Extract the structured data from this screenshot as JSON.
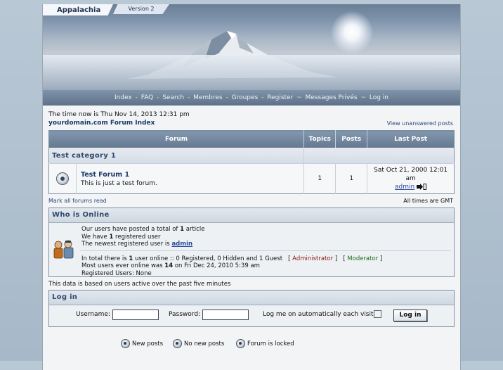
{
  "header": {
    "site_tab": "Appalachia",
    "version_tab": "Version 2"
  },
  "nav": {
    "items": [
      "Index",
      "FAQ",
      "Search",
      "Membres",
      "Groupes",
      "Register",
      "Messages Privés",
      "Log in"
    ]
  },
  "info": {
    "time_text": "The time now is Thu Nov 14, 2013 12:31 pm",
    "index_title": "yourdomain.com Forum Index",
    "view_unanswered": "View unanswered posts"
  },
  "table": {
    "headers": {
      "forum": "Forum",
      "topics": "Topics",
      "posts": "Posts",
      "last_post": "Last Post"
    },
    "category": "Test category 1",
    "forum": {
      "name": "Test Forum 1",
      "description": "This is just a test forum.",
      "topics": "1",
      "posts": "1",
      "last_post_date": "Sat Oct 21, 2000 12:01 am",
      "last_post_user": "admin"
    }
  },
  "below_table": {
    "mark_read": "Mark all forums read",
    "all_times": "All times are GMT"
  },
  "who_online": {
    "title": "Who is Online",
    "line1_pre": "Our users have posted a total of ",
    "line1_num": "1",
    "line1_post": " article",
    "line2_pre": "We have ",
    "line2_num": "1",
    "line2_post": " registered user",
    "line3_pre": "The newest registered user is ",
    "line3_user": "admin",
    "line4_pre": "In total there is ",
    "line4_num": "1",
    "line4_post": " user online :: 0 Registered, 0 Hidden and 1 Guest",
    "admin_label": "Administrator",
    "moderator_label": "Moderator",
    "line5_pre": "Most users ever online was ",
    "line5_num": "14",
    "line5_post": " on Fri Dec 24, 2010 5:39 am",
    "line6": "Registered Users: None"
  },
  "based_on": "This data is based on users active over the past five minutes",
  "login": {
    "title": "Log in",
    "username_label": "Username:",
    "password_label": "Password:",
    "auto_label": "Log me on automatically each visit",
    "button": "Log in"
  },
  "legend": {
    "new_posts": "New posts",
    "no_new_posts": "No new posts",
    "locked": "Forum is locked"
  }
}
